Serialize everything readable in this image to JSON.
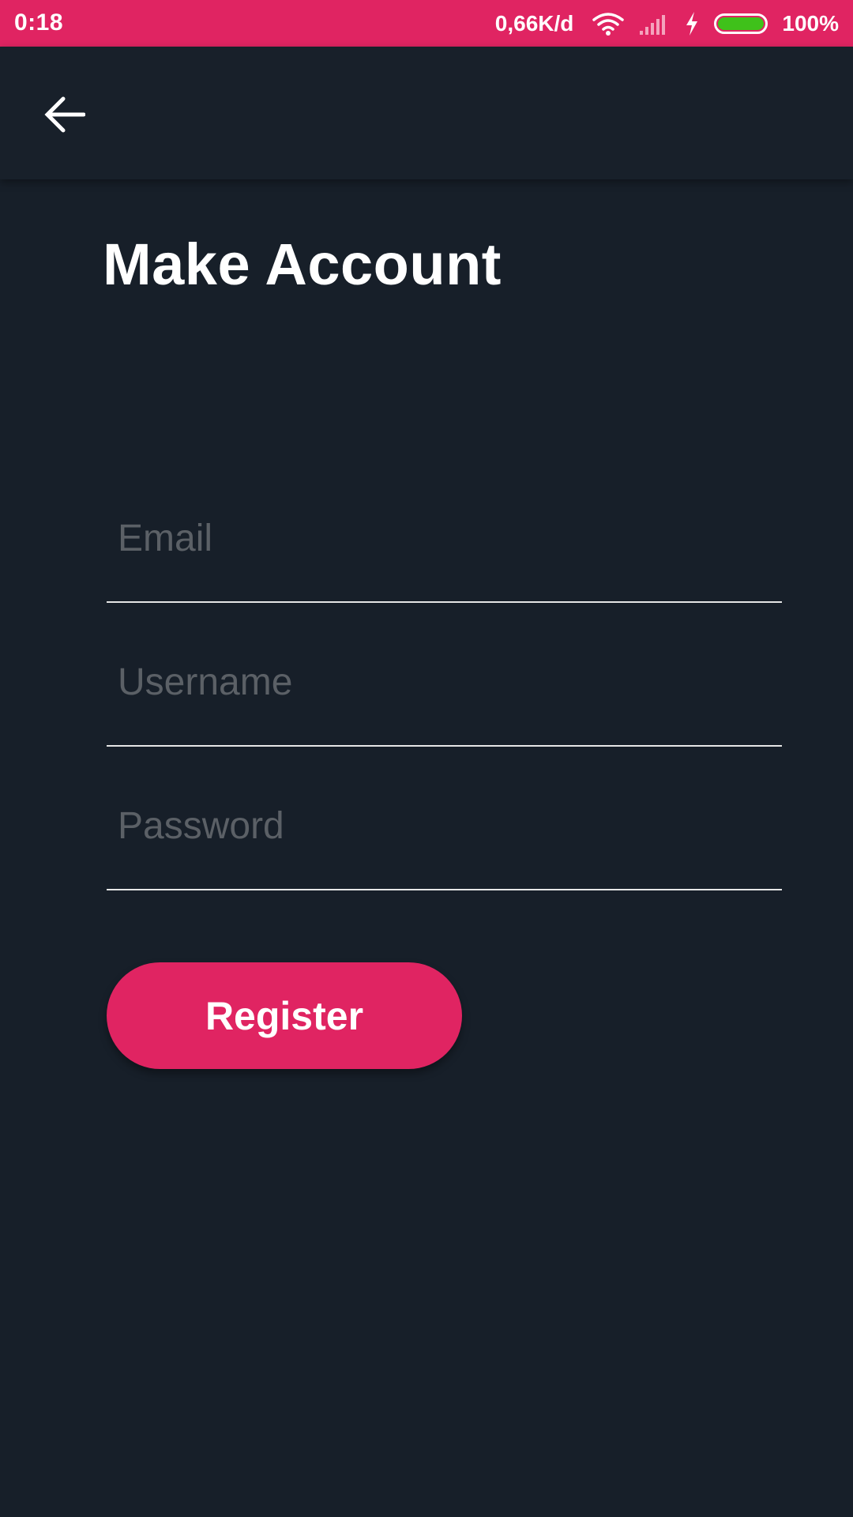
{
  "status_bar": {
    "time": "0:18",
    "network_speed": "0,66K/d",
    "battery_percent": "100%",
    "battery_level": 1.0,
    "icons": [
      "wifi-icon",
      "signal-icon",
      "charging-icon",
      "battery-icon"
    ],
    "background_color": "#e02462",
    "battery_color": "#3fc11a"
  },
  "app_bar": {
    "back_icon": "arrow-left-icon"
  },
  "page": {
    "title": "Make Account",
    "background_color": "#171f29"
  },
  "form": {
    "email": {
      "placeholder": "Email",
      "value": ""
    },
    "username": {
      "placeholder": "Username",
      "value": ""
    },
    "password": {
      "placeholder": "Password",
      "value": ""
    },
    "register_label": "Register",
    "accent_color": "#e02462"
  }
}
